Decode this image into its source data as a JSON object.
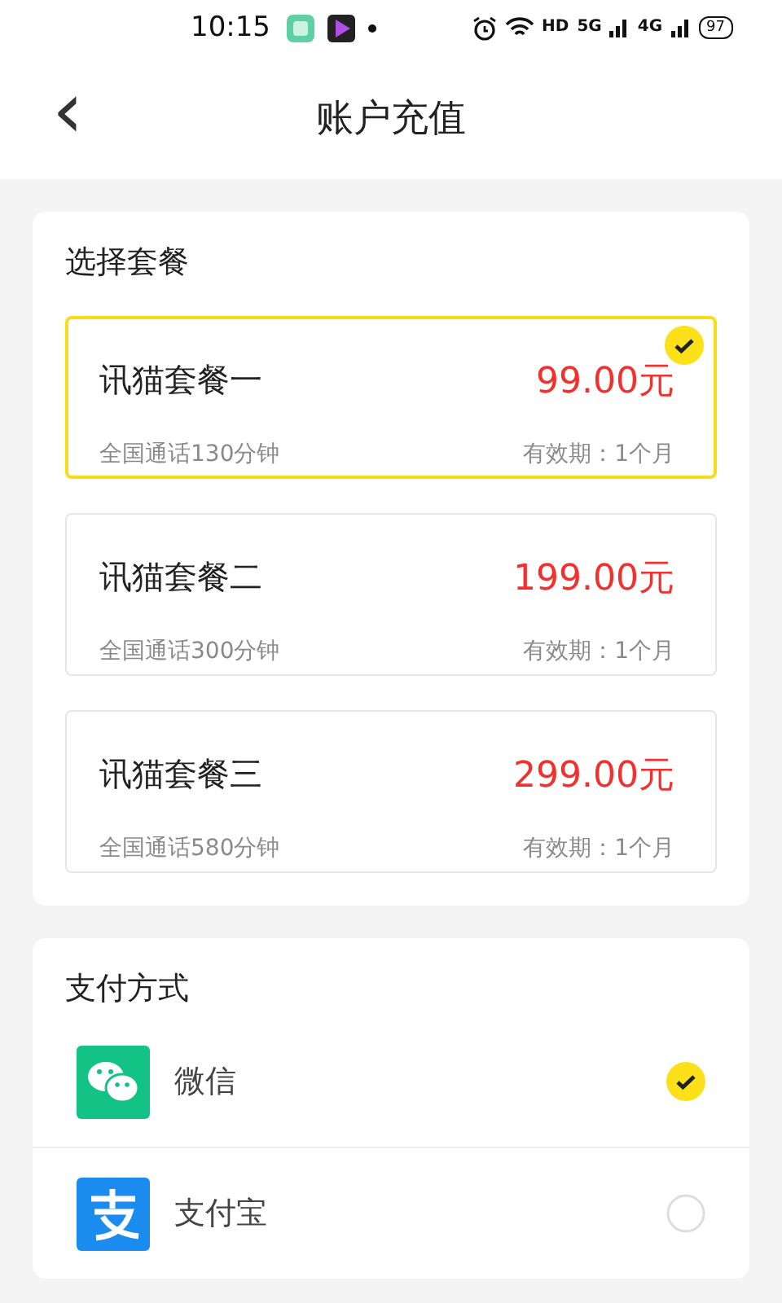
{
  "status_bar": {
    "time": "10:15",
    "network_labels": [
      "HD",
      "5G",
      "4G"
    ],
    "battery": "97"
  },
  "header": {
    "back": "‹",
    "title": "账户充值"
  },
  "plans": {
    "title": "选择套餐",
    "items": [
      {
        "name": "讯猫套餐一",
        "price": "99.00元",
        "minutes": "全国通话130分钟",
        "validity": "有效期：1个月",
        "selected": true
      },
      {
        "name": "讯猫套餐二",
        "price": "199.00元",
        "minutes": "全国通话300分钟",
        "validity": "有效期：1个月",
        "selected": false
      },
      {
        "name": "讯猫套餐三",
        "price": "299.00元",
        "minutes": "全国通话580分钟",
        "validity": "有效期：1个月",
        "selected": false
      }
    ]
  },
  "payment": {
    "title": "支付方式",
    "methods": [
      {
        "kind": "wechat",
        "name": "微信",
        "selected": true
      },
      {
        "kind": "alipay",
        "name": "支付宝",
        "selected": false
      }
    ]
  }
}
